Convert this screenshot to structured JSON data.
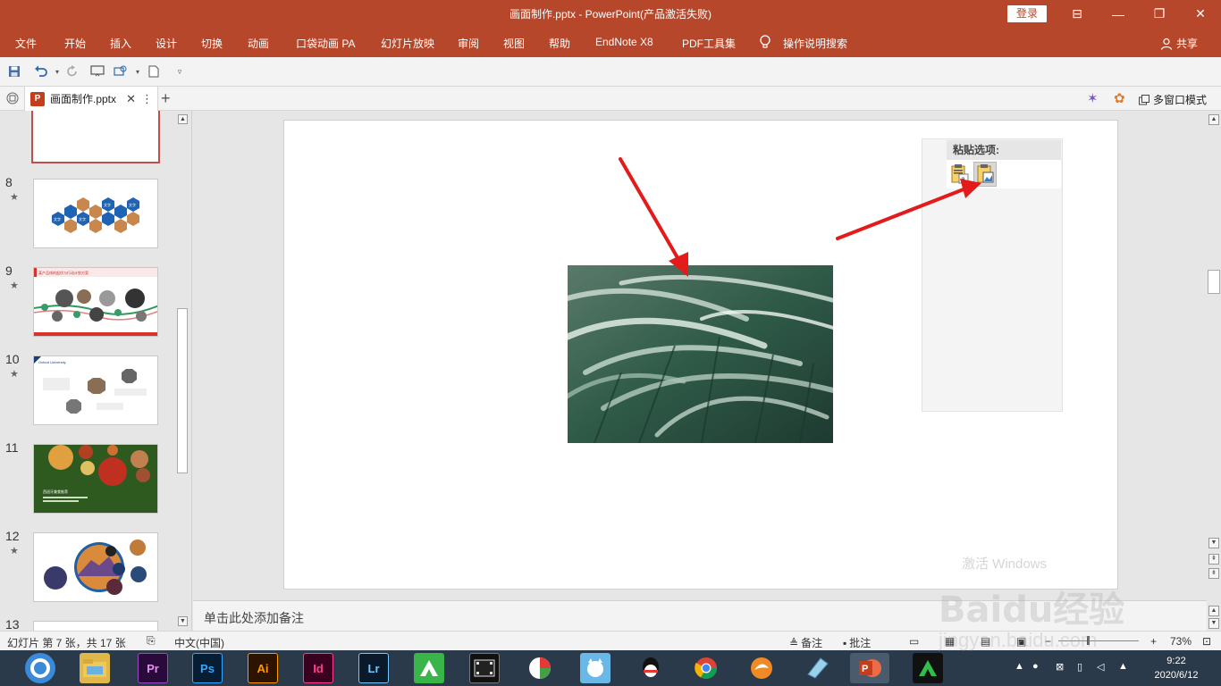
{
  "titlebar": {
    "title": "画面制作.pptx  -  PowerPoint(产品激活失败)",
    "login": "登录",
    "controls": {
      "ribbon_display": "⊟",
      "minimize": "—",
      "restore": "❐",
      "close": "✕"
    }
  },
  "ribbon": {
    "tabs": [
      "文件",
      "开始",
      "插入",
      "设计",
      "切换",
      "动画",
      "口袋动画 PA",
      "幻灯片放映",
      "审阅",
      "视图",
      "帮助",
      "EndNote X8",
      "PDF工具集",
      "操作说明搜索"
    ],
    "share": "共享"
  },
  "qat": {
    "icons": [
      "save-icon",
      "undo-icon",
      "redo-icon",
      "from-beginning-icon",
      "customize-icon",
      "new-icon",
      "more-icon"
    ]
  },
  "doctabs": {
    "file": "画面制作.pptx",
    "multi_window": "多窗口模式"
  },
  "thumbnails": [
    {
      "num": "8",
      "star": "★"
    },
    {
      "num": "9",
      "star": "★"
    },
    {
      "num": "10",
      "star": "★"
    },
    {
      "num": "11",
      "star": ""
    },
    {
      "num": "12",
      "star": "★"
    },
    {
      "num": "13",
      "star": ""
    }
  ],
  "thumb_text": {
    "honeycomb_label": "文字",
    "slide9_header": "某产品线的起伏与行动计划方案",
    "slide10_header": "Oxford University",
    "slide11_title": "西班牙美食推荐"
  },
  "paste_panel": {
    "header": "粘贴选项:",
    "options": [
      "keep-text-only-icon",
      "picture-icon"
    ]
  },
  "notes": {
    "placeholder": "单击此处添加备注"
  },
  "status": {
    "slide_info": "幻灯片 第 7 张，共 17 张",
    "language": "中文(中国)",
    "notes": "备注",
    "comments": "批注",
    "zoom": "73%"
  },
  "taskbar": {
    "apps": [
      "Pr",
      "Ps",
      "Ai",
      "Id",
      "Lr"
    ],
    "time": "9:22",
    "date": "2020/6/12"
  },
  "watermark": {
    "activate": "激活 Windows",
    "brand": "Baidu经验",
    "url": "jingyan.baidu.com"
  },
  "colors": {
    "accent": "#b7472a",
    "taskbar": "#2b3a4a",
    "arrow": "#e31b1b"
  }
}
